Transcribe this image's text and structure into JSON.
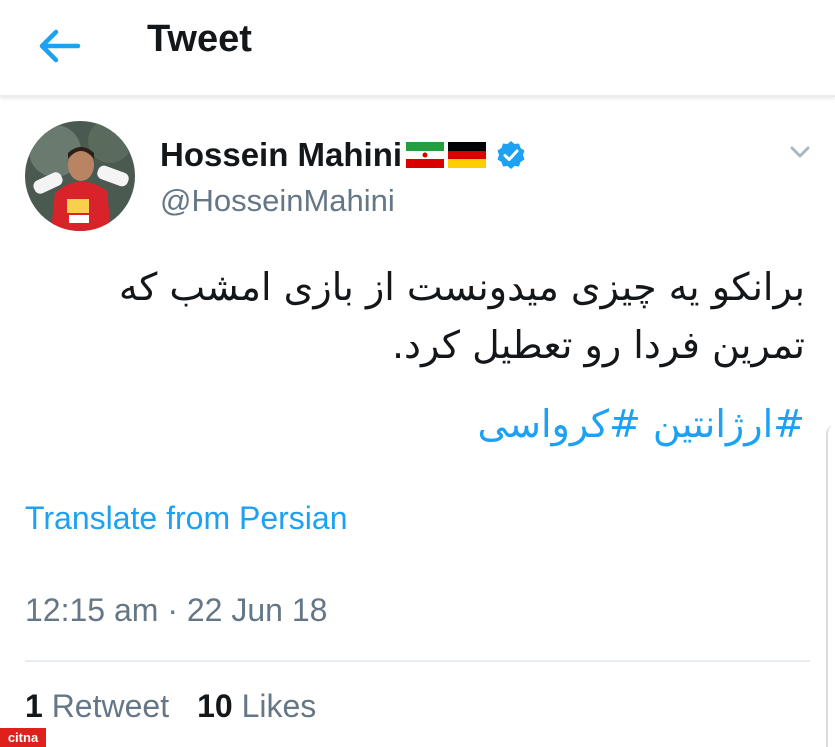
{
  "header": {
    "title": "Tweet",
    "back_icon": "arrow-left-icon"
  },
  "tweet": {
    "author": {
      "display_name": "Hossein Mahini",
      "handle": "@HosseinMahini",
      "flags": [
        "iran-flag-icon",
        "germany-flag-icon"
      ],
      "verified": true
    },
    "text_line1": "برانکو یه چیزی میدونست از بازی امشب که",
    "text_line2": "تمرین فردا رو تعطیل کرد.",
    "hashtags": [
      "#ارژانتین",
      "#کرواسی"
    ],
    "translate_label": "Translate from Persian",
    "timestamp": "12:15 am · 22 Jun 18",
    "retweets_count": "1",
    "retweets_label": "Retweet",
    "likes_count": "10",
    "likes_label": "Likes"
  },
  "watermark": "citna",
  "colors": {
    "accent": "#1da1f2",
    "secondary_text": "#657786",
    "divider": "#e6ecf0"
  }
}
